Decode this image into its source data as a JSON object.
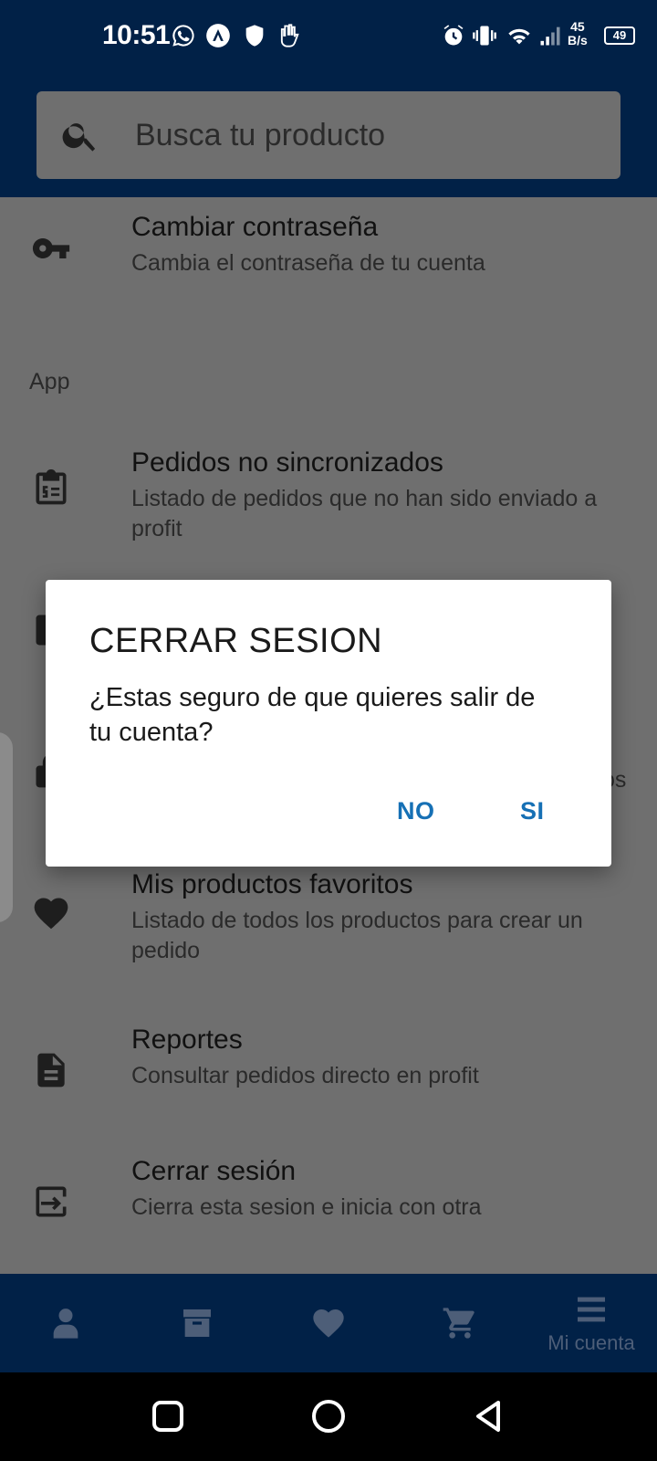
{
  "status_bar": {
    "time": "10:51",
    "net_speed_value": "45",
    "net_speed_unit": "B/s",
    "battery": "49"
  },
  "search": {
    "placeholder": "Busca tu producto",
    "icon": "search-icon"
  },
  "list": {
    "items_top": [
      {
        "icon": "key-icon",
        "title": "Cambiar contraseña",
        "subtitle": "Cambia el contraseña de tu cuenta"
      }
    ],
    "section_label": "App",
    "items": [
      {
        "icon": "clipboard-list-icon",
        "title": "Pedidos no sincronizados",
        "subtitle": "Listado de pedidos que no han sido enviado a profit"
      },
      {
        "icon": "heart-icon",
        "title": "Mis productos favoritos",
        "subtitle": "Listado de todos los productos para crear un pedido"
      },
      {
        "icon": "document-icon",
        "title": "Reportes",
        "subtitle": "Consultar pedidos directo en profit"
      },
      {
        "icon": "logout-icon",
        "title": "Cerrar sesión",
        "subtitle": "Cierra esta sesion e inicia con otra"
      }
    ],
    "partial_text": "os"
  },
  "dialog": {
    "title": "CERRAR SESION",
    "message": "¿Estas seguro de que quieres salir de tu cuenta?",
    "no_label": "NO",
    "yes_label": "SI"
  },
  "bottom_nav": {
    "items": [
      {
        "icon": "user-icon",
        "label": ""
      },
      {
        "icon": "archive-icon",
        "label": ""
      },
      {
        "icon": "heart-icon",
        "label": ""
      },
      {
        "icon": "cart-icon",
        "label": ""
      },
      {
        "icon": "menu-icon",
        "label": "Mi cuenta"
      }
    ]
  },
  "colors": {
    "primary": "#012147",
    "accent": "#1670b5",
    "scrim_bg": "#6f6f6f"
  }
}
